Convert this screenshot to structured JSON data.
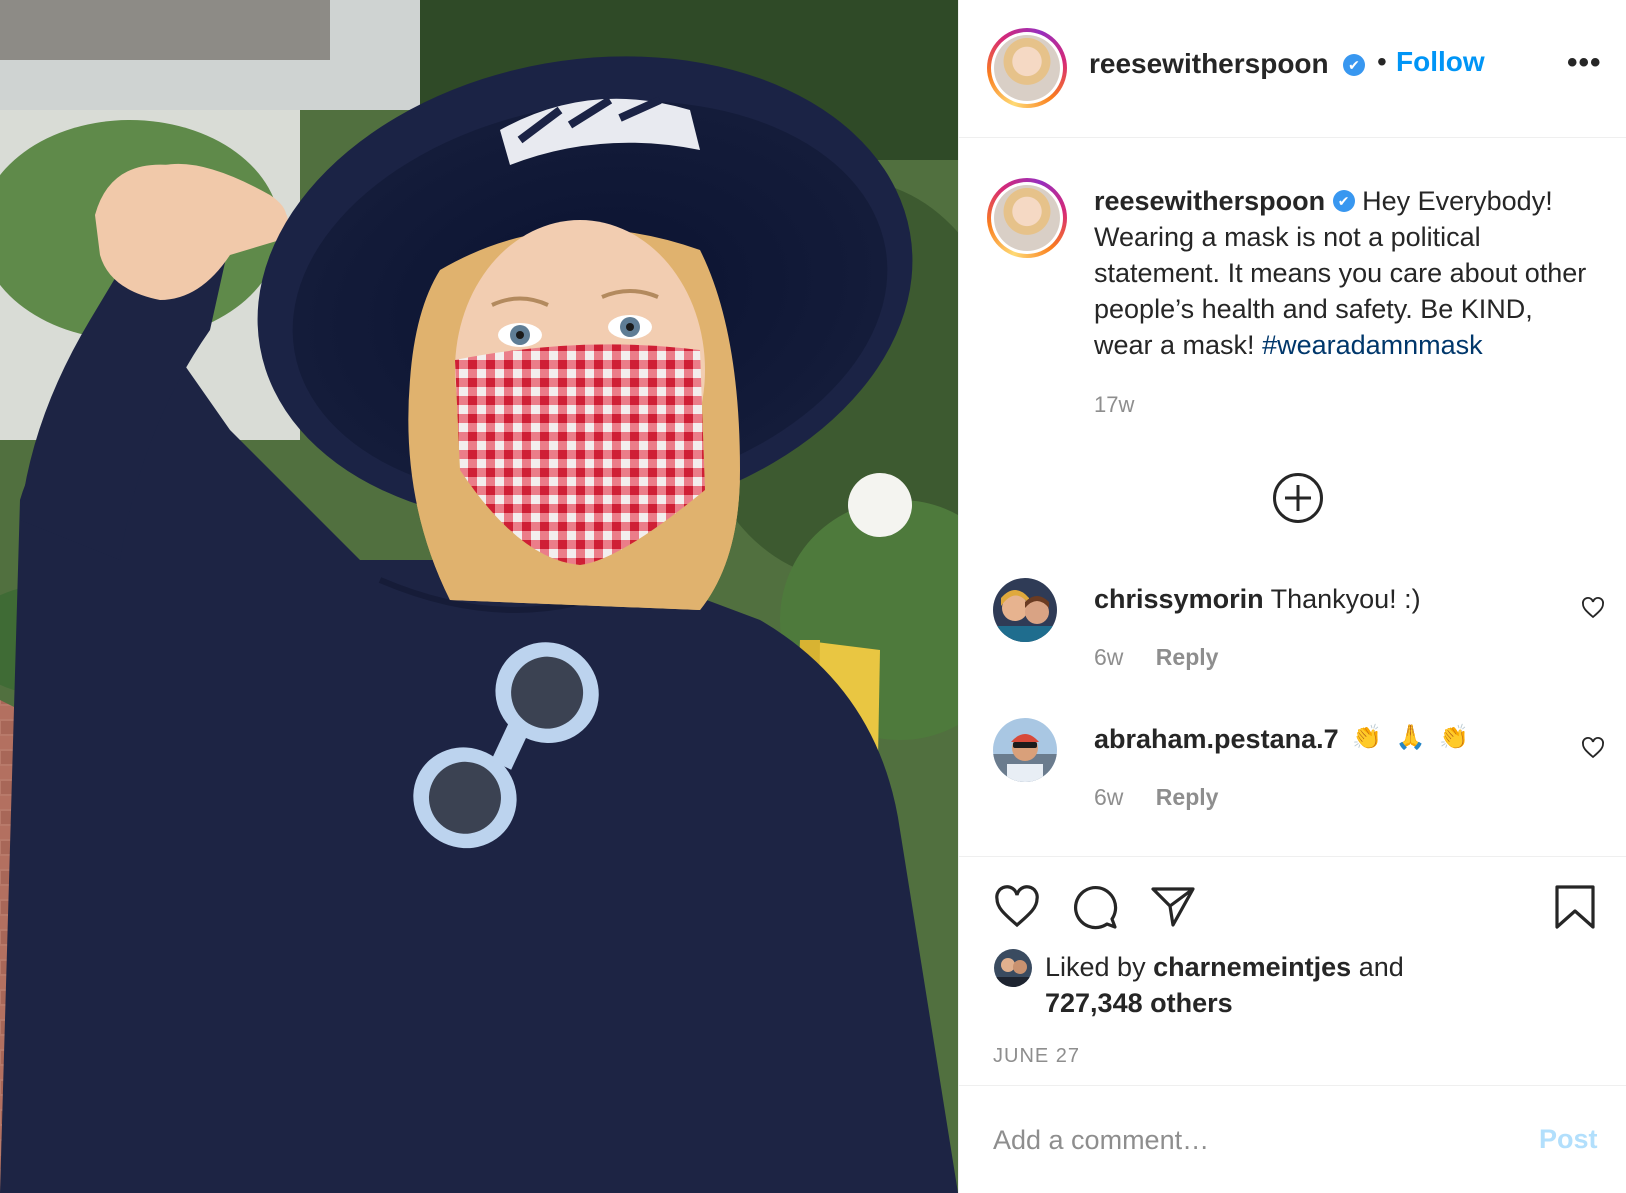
{
  "post": {
    "author": "reesewitherspoon",
    "verified_mark": "✔",
    "separator": "•",
    "follow_label": "Follow",
    "more_label": "•••",
    "caption_text": "Hey Everybody! Wearing a mask is not a political statement. It means you care about other people’s health and safety. Be KIND, wear a mask!",
    "caption_hashtag": "#wearadamnmask",
    "caption_age": "17w",
    "likes_prefix": "Liked by",
    "liked_by_user": "charnemeintjes",
    "likes_and": "and",
    "likes_count": "727,348 others",
    "date": "JUNE 27"
  },
  "comments": [
    {
      "username": "chrissymorin",
      "text": "Thankyou! :)",
      "emojis": [],
      "age": "6w",
      "reply_label": "Reply"
    },
    {
      "username": "abraham.pestana.7",
      "text": "",
      "emojis": [
        "👏",
        "🙏",
        "👏"
      ],
      "age": "6w",
      "reply_label": "Reply"
    }
  ],
  "add_comment": {
    "placeholder": "Add a comment…",
    "post_label": "Post"
  },
  "colors": {
    "link": "#0095f6",
    "hashtag": "#00376b",
    "muted": "#8e8e8e",
    "post_disabled": "#b2dffc",
    "verified": "#3897f0"
  },
  "icons": {
    "like": "heart-icon",
    "comment": "comment-bubble-icon",
    "share": "paper-plane-icon",
    "save": "bookmark-icon",
    "load_more": "plus-circle-icon"
  }
}
